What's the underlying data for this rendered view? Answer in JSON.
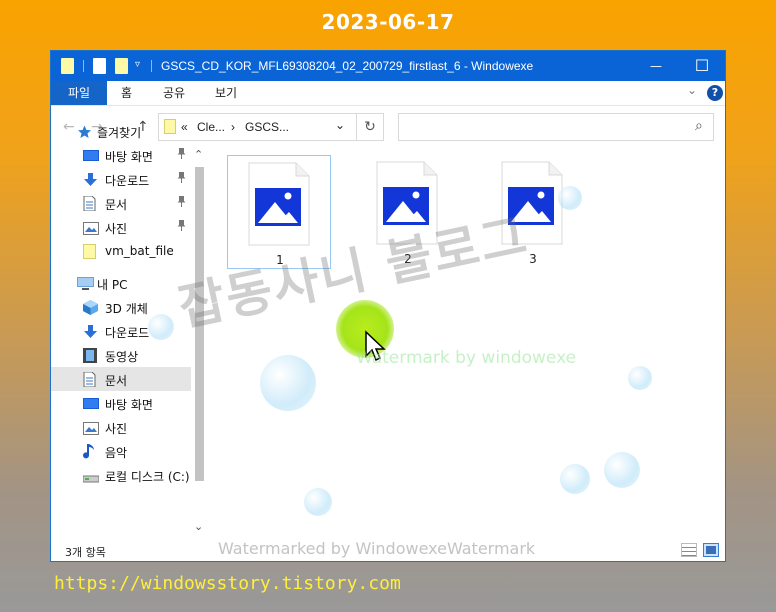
{
  "date": "2023-06-17",
  "url": "https://windowsstory.tistory.com",
  "window": {
    "title": "GSCS_CD_KOR_MFL69308204_02_200729_firstlast_6   - Windowexe",
    "controls": {
      "minimize": "—",
      "maximize": "☐",
      "close": "✕"
    }
  },
  "ribbon": {
    "tabs": [
      "파일",
      "홈",
      "공유",
      "보기"
    ],
    "help": "?",
    "collapse": "⌄"
  },
  "nav": {
    "back": "←",
    "forward": "→",
    "recent": "⌄",
    "up": "↑"
  },
  "address": {
    "prefix": "«",
    "crumbs": [
      "Cle...",
      "GSCS..."
    ],
    "sep": "›",
    "dropdown": "⌄",
    "refresh": "↻"
  },
  "search": {
    "placeholder": "",
    "icon": "⌕"
  },
  "sidebar": {
    "scroll_up": "⌃",
    "scroll_down": "⌄",
    "items": [
      {
        "label": "즐겨찾기",
        "icon": "star-icon"
      },
      {
        "label": "바탕 화면",
        "icon": "desktop-icon",
        "pinned": true
      },
      {
        "label": "다운로드",
        "icon": "download-icon",
        "pinned": true
      },
      {
        "label": "문서",
        "icon": "document-icon",
        "pinned": true
      },
      {
        "label": "사진",
        "icon": "pictures-icon",
        "pinned": true
      },
      {
        "label": "vm_bat_file",
        "icon": "folder-icon"
      },
      {
        "label": "내 PC",
        "icon": "pc-icon"
      },
      {
        "label": "3D 개체",
        "icon": "3d-objects-icon"
      },
      {
        "label": "다운로드",
        "icon": "download-icon"
      },
      {
        "label": "동영상",
        "icon": "video-icon"
      },
      {
        "label": "문서",
        "icon": "document-icon",
        "selected": true
      },
      {
        "label": "바탕 화면",
        "icon": "desktop-icon"
      },
      {
        "label": "사진",
        "icon": "pictures-icon"
      },
      {
        "label": "음악",
        "icon": "music-icon"
      },
      {
        "label": "로컬 디스크 (C:)",
        "icon": "drive-icon"
      }
    ],
    "pin_glyph": "📌"
  },
  "files": [
    {
      "name": "1",
      "selected": true
    },
    {
      "name": "2"
    },
    {
      "name": "3"
    }
  ],
  "status": {
    "count": "3개 항목"
  },
  "watermarks": {
    "korean": "잡동사니 블로그",
    "green": "Watermark by windowexe",
    "bottom": "Watermarked by WindowexeWatermark"
  },
  "colors": {
    "titlebar": "#0a64d6",
    "accent": "#1565c9",
    "image_blue": "#1a3fd6",
    "background_top": "#f9a300"
  }
}
